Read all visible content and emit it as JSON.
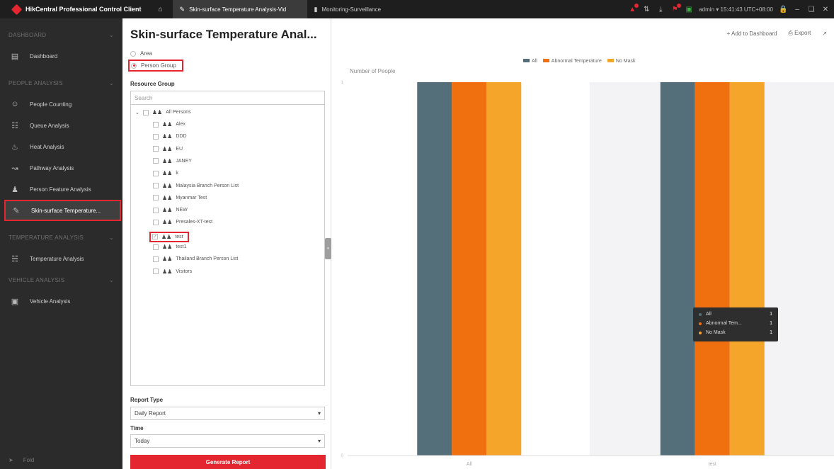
{
  "titlebar": {
    "app_name": "HikCentral Professional Control Client",
    "active_tab": "Skin-surface Temperature Analysis-Vid",
    "other_tab": "Monitoring-Surveillance",
    "user": "admin",
    "time": "15:41:43 UTC+08:00"
  },
  "sidebar": {
    "dashboard_section": "DASHBOARD",
    "dashboard_item": "Dashboard",
    "people_section": "PEOPLE ANALYSIS",
    "people_items": [
      "People Counting",
      "Queue Analysis",
      "Heat Analysis",
      "Pathway Analysis",
      "Person Feature Analysis",
      "Skin-surface Temperature..."
    ],
    "temperature_section": "TEMPERATURE ANALYSIS",
    "temperature_item": "Temperature Analysis",
    "vehicle_section": "VEHICLE ANALYSIS",
    "vehicle_item": "Vehicle Analysis",
    "fold": "Fold"
  },
  "panel": {
    "title": "Skin-surface Temperature Anal...",
    "radio_area": "Area",
    "radio_person_group": "Person Group",
    "resource_group_label": "Resource Group",
    "search_placeholder": "Search",
    "root": "All Persons",
    "groups": [
      "Alex",
      "DDD",
      "EU",
      "JANEY",
      "k",
      "Malaysia Branch Person List",
      "Myanmar Test",
      "NEW",
      "Presales-XT-test",
      "test",
      "test1",
      "Thailand Branch Person List",
      "Visitors"
    ],
    "report_type_label": "Report Type",
    "report_type_value": "Daily Report",
    "time_label": "Time",
    "time_value": "Today",
    "generate_button": "Generate Report"
  },
  "toolbar": {
    "add_to_dashboard": "Add to Dashboard",
    "export": "Export"
  },
  "chart_data": {
    "type": "bar",
    "ylabel": "Number of People",
    "categories": [
      "All",
      "test"
    ],
    "series": [
      {
        "name": "All",
        "values": [
          1,
          1
        ],
        "color": "#546e7a"
      },
      {
        "name": "Abnormal Temperature",
        "values": [
          1,
          1
        ],
        "color": "#f07010"
      },
      {
        "name": "No Mask",
        "values": [
          1,
          1
        ],
        "color": "#f4a52a"
      }
    ],
    "ylim": [
      0,
      1
    ],
    "yticks": [
      "0",
      "1"
    ],
    "legend": "top-center",
    "tooltip": {
      "rows": [
        {
          "name": "All",
          "value": "1",
          "color": "#546e7a"
        },
        {
          "name": "Abnormal Tem...",
          "value": "1",
          "color": "#f07010"
        },
        {
          "name": "No Mask",
          "value": "1",
          "color": "#f4a52a"
        }
      ]
    }
  }
}
